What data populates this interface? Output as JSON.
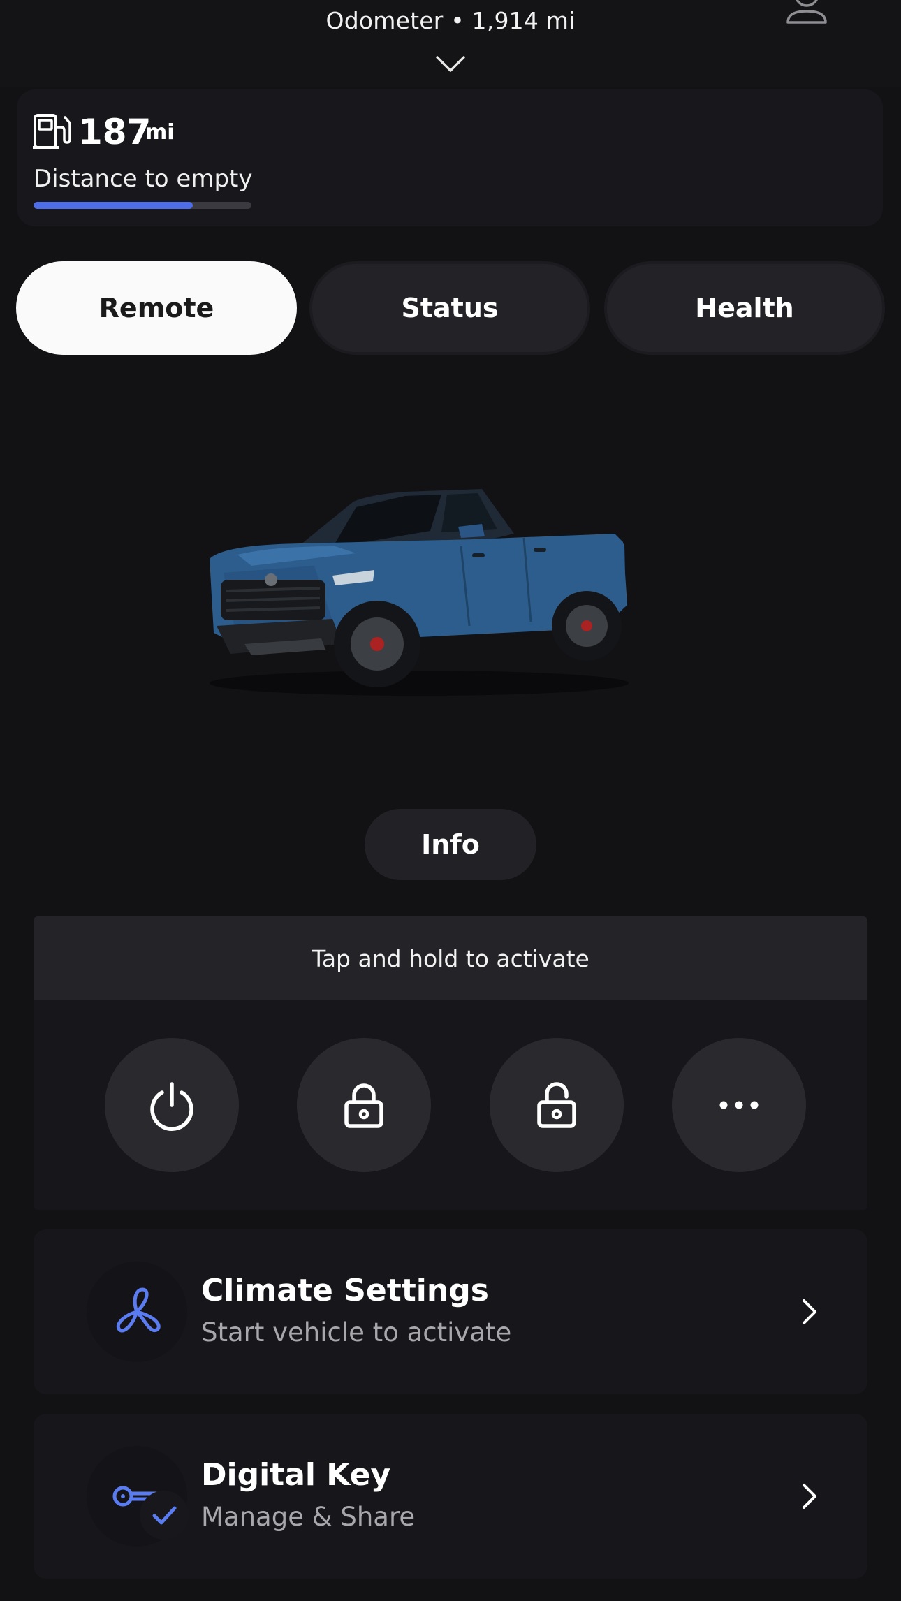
{
  "header": {
    "odometer": "Odometer • 1,914 mi"
  },
  "fuel": {
    "range_value": "187",
    "range_unit": "mi",
    "label": "Distance to empty",
    "level_fraction": 0.73
  },
  "tabs": [
    {
      "label": "Remote",
      "active": true
    },
    {
      "label": "Status",
      "active": false
    },
    {
      "label": "Health",
      "active": false
    }
  ],
  "vehicle": {
    "info_label": "Info"
  },
  "remote": {
    "hint": "Tap and hold to activate",
    "actions": [
      {
        "icon": "power-icon"
      },
      {
        "icon": "lock-icon"
      },
      {
        "icon": "unlock-icon"
      },
      {
        "icon": "more-icon"
      }
    ]
  },
  "cards": [
    {
      "title": "Climate Settings",
      "subtitle": "Start vehicle to activate",
      "icon": "fan-icon"
    },
    {
      "title": "Digital Key",
      "subtitle": "Manage & Share",
      "icon": "key-icon",
      "badge": "check-icon"
    }
  ],
  "colors": {
    "background": "#121215",
    "card": "#17171b",
    "accent": "#4d6ee8",
    "tab_active_bg": "#fafafa",
    "tab_inactive_bg": "#232327"
  }
}
